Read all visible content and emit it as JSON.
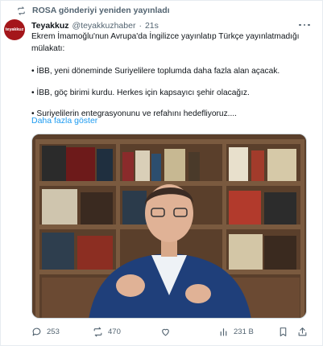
{
  "repost": {
    "icon": "repost-icon",
    "text": "ROSA gönderiyi yeniden yayınladı"
  },
  "author": {
    "avatar_text": "teyakkuz",
    "name": "Teyakkuz",
    "handle": "@teyakkuzhaber",
    "separator": "·",
    "time": "21s"
  },
  "body": {
    "intro": "Ekrem İmamoğlu'nun Avrupa'da İngilizce yayınlatıp Türkçe yayınlatmadığı mülakatı:",
    "bullets": [
      "• İBB, yeni döneminde Suriyelilere toplumda daha fazla alan açacak.",
      "• İBB, göç birimi kurdu. Herkes için kapsayıcı şehir olacağız.",
      "• Suriyelilerin entegrasyonunu ve refahını hedefliyoruz...."
    ],
    "show_more": "Daha fazla göster"
  },
  "actions": {
    "reply_count": "253",
    "repost_count": "470",
    "like_count": "",
    "views_count": "231 B"
  },
  "colors": {
    "accent": "#1d9bf0",
    "muted": "#536471",
    "avatar_bg": "#a4161a"
  }
}
